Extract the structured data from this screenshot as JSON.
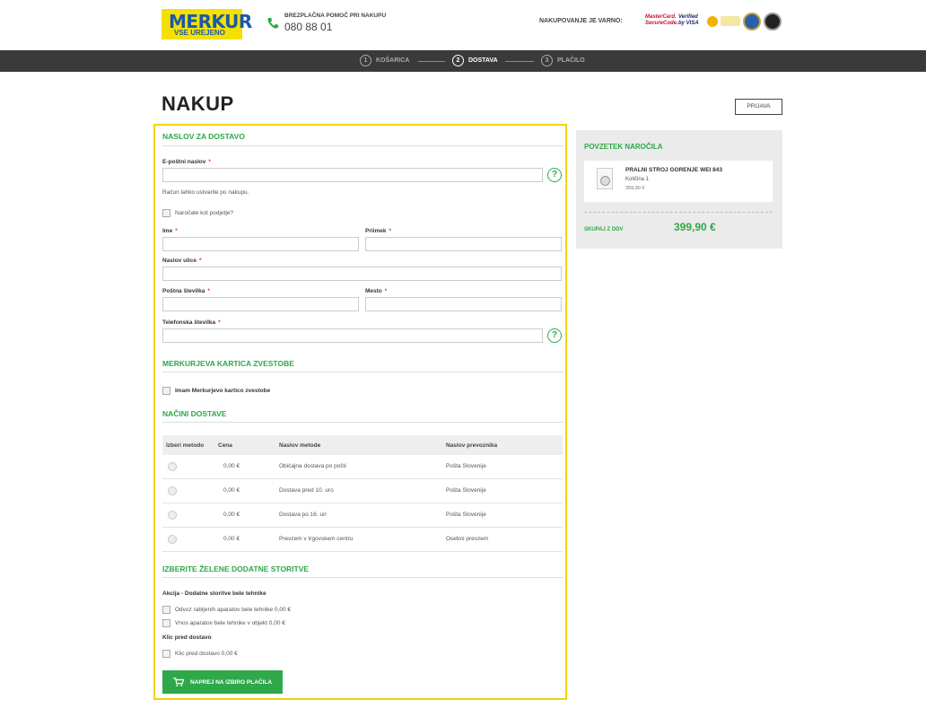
{
  "header": {
    "logo_name": "MERKUR",
    "logo_tagline": "VSE UREJENO",
    "help_label": "BREZPLAČNA POMOČ PRI NAKUPU",
    "help_phone": "080 88 01",
    "secure_label": "NAKUPOVANJE JE VARNO:",
    "payment_logos": [
      "MasterCard. SecureCode.",
      "Verified by VISA"
    ]
  },
  "steps": [
    {
      "number": "1",
      "label": "KOŠARICA"
    },
    {
      "number": "2",
      "label": "DOSTAVA"
    },
    {
      "number": "3",
      "label": "PLAČILO"
    }
  ],
  "page_title": "NAKUP",
  "login_button": "PRIJAVA",
  "address": {
    "heading": "NASLOV ZA DOSTAVO",
    "email_label": "E-poštni naslov",
    "email_value": "",
    "account_note": "Račun lahko ustvarite po nakupu.",
    "company_checkbox": "Naročate kot podjetje?",
    "first_name_label": "Ime",
    "first_name_value": "",
    "last_name_label": "Priimek",
    "last_name_value": "",
    "street_label": "Naslov ulice",
    "street_value": "",
    "postcode_label": "Poštna številka",
    "postcode_value": "",
    "city_label": "Mesto",
    "city_value": "",
    "phone_label": "Telefonska številka",
    "phone_value": "",
    "help_symbol": "?",
    "required_mark": "*"
  },
  "loyalty": {
    "heading": "MERKURJEVA KARTICA ZVESTOBE",
    "checkbox_label": "Imam Merkurjevo kartico zvestobe"
  },
  "shipping": {
    "heading": "NAČINI DOSTAVE",
    "columns": [
      "Izberi metodo",
      "Cena",
      "Naslov metode",
      "Naslov prevoznika"
    ],
    "rows": [
      {
        "price": "0,00 €",
        "method": "Običajna dostava po pošti",
        "carrier": "Pošta Slovenije"
      },
      {
        "price": "0,00 €",
        "method": "Dostava pred 10. uro",
        "carrier": "Pošta Slovenije"
      },
      {
        "price": "0,00 €",
        "method": "Dostava po 16. uri",
        "carrier": "Pošta Slovenije"
      },
      {
        "price": "0,00 €",
        "method": "Prevzem v trgovskem centru",
        "carrier": "Osebni prevzem"
      }
    ]
  },
  "extras": {
    "heading": "IZBERITE ŽELENE DODATNE STORITVE",
    "group1_title": "Akcija - Dodatne storitve bele tehnike",
    "option1": "Odvoz rabljenih aparatov bele tehnike 0,00 €",
    "option2": "Vnos aparatov bele tehnike v objekt 0,00 €",
    "group2_title": "Klic pred dostavo",
    "option3": "Klic pred dostavo 0,00 €"
  },
  "cta_label": "NAPREJ NA IZBIRO PLAČILA",
  "summary": {
    "heading": "POVZETEK NAROČILA",
    "product_name": "PRALNI STROJ GORENJE WEI 843",
    "quantity": "Količina 1",
    "unit_price": "399,90 €",
    "total_label": "SKUPAJ Z DDV",
    "total_value": "399,90 €"
  },
  "colors": {
    "accent_green": "#2ea84a",
    "highlight_yellow": "#f5d400",
    "steps_bar": "#3a3a3a",
    "brand_blue": "#1a5aa8"
  },
  "icons": [
    "phone-icon",
    "help-icon",
    "cart-icon",
    "washing-machine-icon"
  ]
}
